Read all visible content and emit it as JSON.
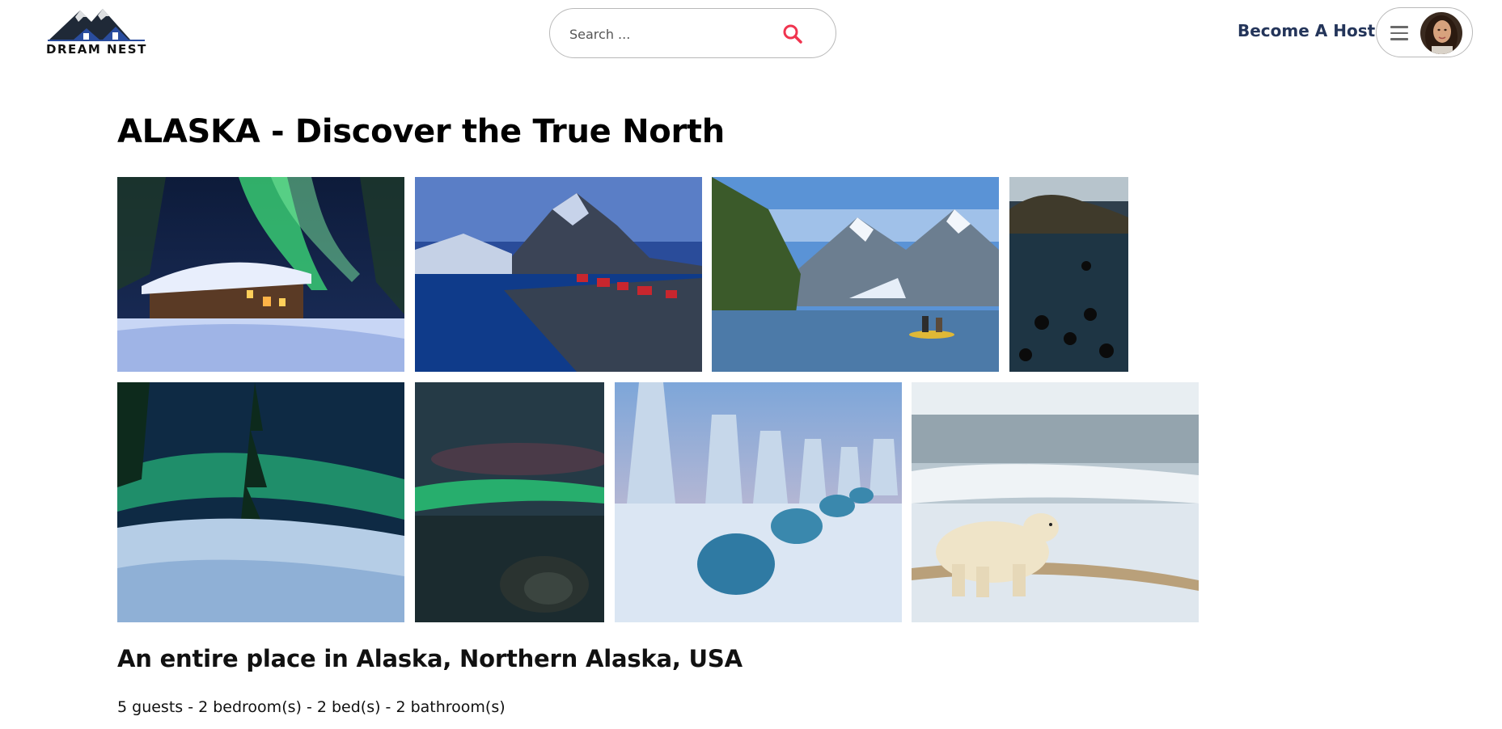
{
  "brand": {
    "name": "DREAM NEST",
    "logo_icon": "house-mountain-logo",
    "accent": "#2a4d9e"
  },
  "search": {
    "placeholder": "Search ...",
    "icon": "search-icon",
    "icon_color": "#f0344f"
  },
  "header": {
    "become_host_label": "Become A Host",
    "menu_icon": "hamburger-icon",
    "avatar": "user-avatar"
  },
  "listing": {
    "title": "ALASKA - Discover the True North",
    "subtitle": "An entire place in Alaska, Northern Alaska, USA",
    "details": "5 guests - 2 bedroom(s) - 2 bed(s) - 2 bathroom(s)",
    "photos": [
      "northern-lights-cabin",
      "fjord-red-houses",
      "glacier-kayak",
      "divers-in-water",
      "aurora-snowy-trees",
      "aurora-over-sea",
      "glass-igloos-forest",
      "polar-bear-ice"
    ]
  }
}
